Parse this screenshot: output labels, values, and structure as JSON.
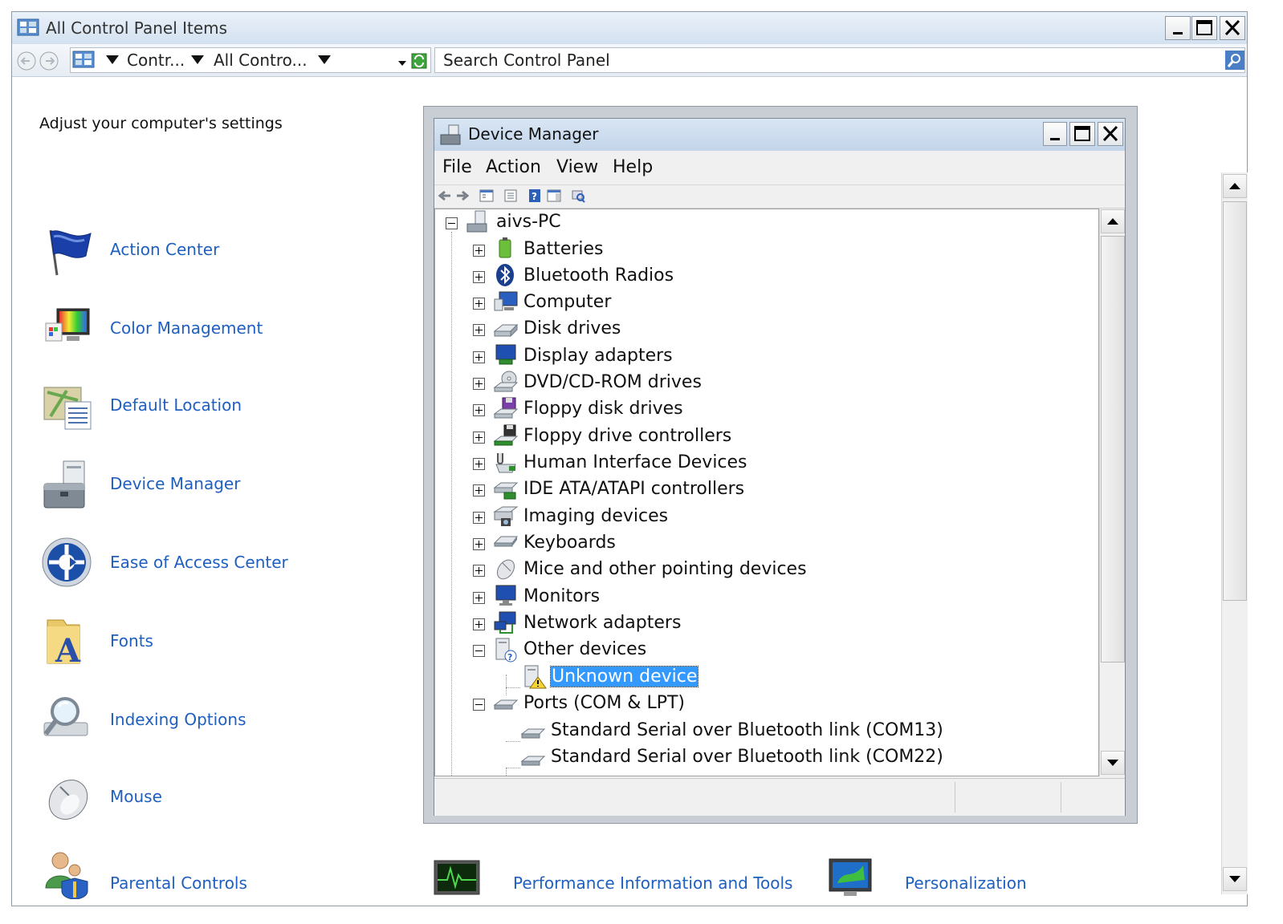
{
  "window": {
    "title": "All Control Panel Items",
    "breadcrumb": [
      "Contr...",
      "All Contro..."
    ],
    "search_placeholder": "Search Control Panel"
  },
  "control_panel": {
    "heading": "Adjust your computer's settings",
    "items": [
      {
        "label": "Action Center",
        "icon": "flag-icon"
      },
      {
        "label": "Color Management",
        "icon": "color-management-icon"
      },
      {
        "label": "Default Location",
        "icon": "default-location-icon"
      },
      {
        "label": "Device Manager",
        "icon": "device-manager-icon"
      },
      {
        "label": "Ease of Access Center",
        "icon": "ease-of-access-icon"
      },
      {
        "label": "Fonts",
        "icon": "fonts-folder-icon"
      },
      {
        "label": "Indexing Options",
        "icon": "magnifier-icon"
      },
      {
        "label": "Mouse",
        "icon": "mouse-icon"
      },
      {
        "label": "Parental Controls",
        "icon": "parental-controls-icon"
      },
      {
        "label": "Performance Information and Tools",
        "icon": "performance-monitor-icon"
      },
      {
        "label": "Personalization",
        "icon": "personalization-icon"
      }
    ]
  },
  "device_manager": {
    "title": "Device Manager",
    "menu": [
      "File",
      "Action",
      "View",
      "Help"
    ],
    "tree": {
      "root": "aivs-PC",
      "categories": [
        "Batteries",
        "Bluetooth Radios",
        "Computer",
        "Disk drives",
        "Display adapters",
        "DVD/CD-ROM drives",
        "Floppy disk drives",
        "Floppy drive controllers",
        "Human Interface Devices",
        "IDE ATA/ATAPI controllers",
        "Imaging devices",
        "Keyboards",
        "Mice and other pointing devices",
        "Monitors",
        "Network adapters",
        "Other devices",
        "Ports (COM & LPT)"
      ],
      "other_devices_children": [
        "Unknown device"
      ],
      "ports_children": [
        "Standard Serial over Bluetooth link (COM13)",
        "Standard Serial over Bluetooth link (COM22)"
      ],
      "selected": "Unknown device"
    }
  },
  "colors": {
    "link": "#1e5fbf",
    "selection": "#3399ff",
    "titlebar": "#d3e1f0"
  }
}
